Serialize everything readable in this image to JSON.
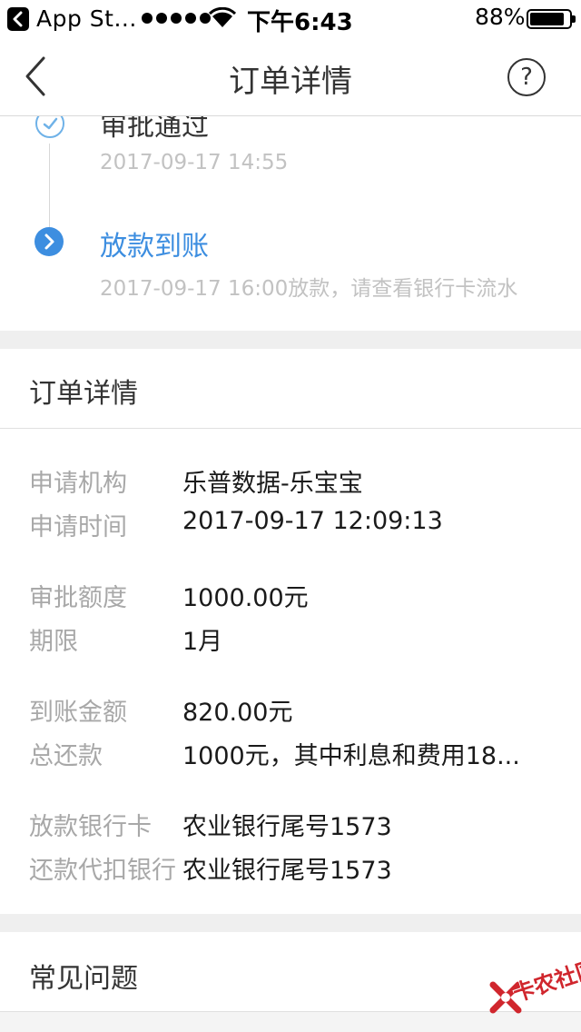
{
  "status_bar": {
    "back_app_label": "App St...",
    "time": "下午6:43",
    "battery_pct": "88%",
    "battery_level": 0.88
  },
  "nav": {
    "title": "订单详情"
  },
  "timeline": {
    "steps": [
      {
        "title": "审批通过",
        "subtitle": "2017-09-17 14:55"
      },
      {
        "title": "放款到账",
        "subtitle": "2017-09-17 16:00放款，请查看银行卡流水"
      }
    ],
    "accent_color": "#3d8ee0"
  },
  "order_details": {
    "header": "订单详情",
    "rows": [
      {
        "label": "申请机构",
        "value": "乐普数据-乐宝宝"
      },
      {
        "label": "申请时间",
        "value": "2017-09-17 12:09:13"
      },
      {
        "label": "审批额度",
        "value": "1000.00元"
      },
      {
        "label": "期限",
        "value": "1月"
      },
      {
        "label": "到账金额",
        "value": "820.00元"
      },
      {
        "label": "总还款",
        "value": "1000元，其中利息和费用18..."
      },
      {
        "label": "放款银行卡",
        "value": "农业银行尾号1573"
      },
      {
        "label": "还款代扣银行",
        "value": "农业银行尾号1573"
      }
    ]
  },
  "faq": {
    "header": "常见问题"
  },
  "watermark": {
    "text": "卡农社区"
  }
}
